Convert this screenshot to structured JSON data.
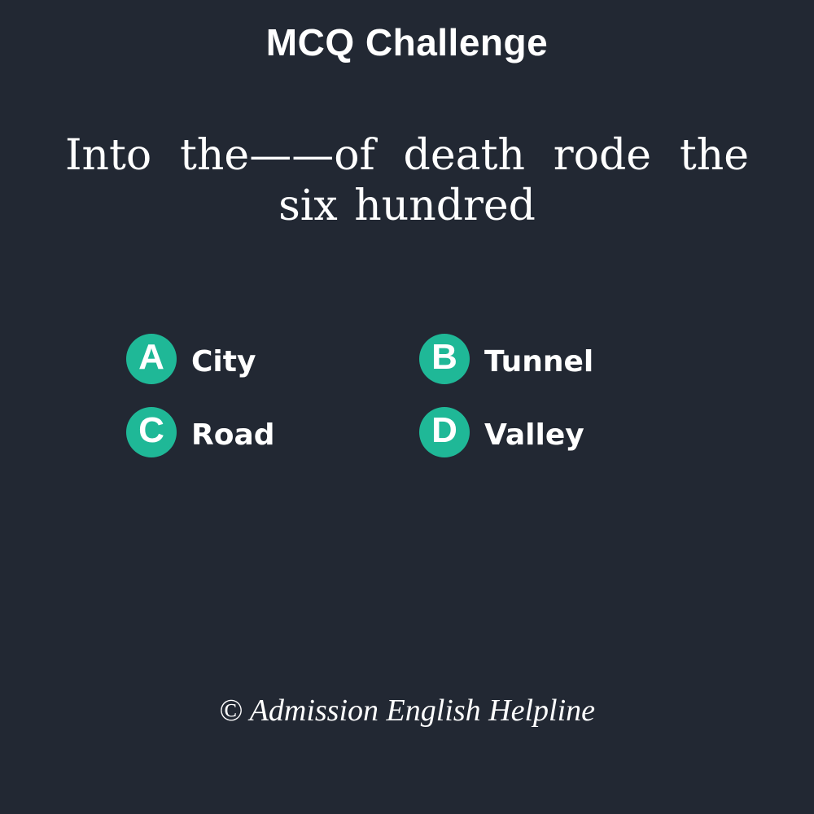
{
  "title": "MCQ Challenge",
  "question": "Into the——of death rode the six hundred",
  "options": [
    {
      "letter": "A",
      "text": "City"
    },
    {
      "letter": "B",
      "text": "Tunnel"
    },
    {
      "letter": "C",
      "text": "Road"
    },
    {
      "letter": "D",
      "text": "Valley"
    }
  ],
  "footer": "© Admission English Helpline",
  "colors": {
    "background": "#222833",
    "accent": "#1fb897",
    "text": "#ffffff"
  }
}
